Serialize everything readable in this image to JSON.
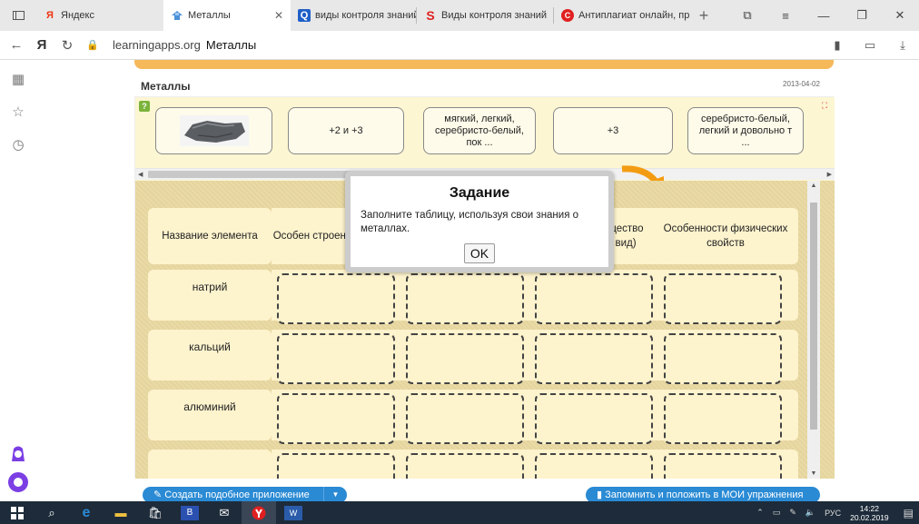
{
  "browser": {
    "tabs": [
      {
        "label": "Яндекс",
        "icon": "yandex-icon"
      },
      {
        "label": "Металлы",
        "icon": "learningapps-icon",
        "active": true
      },
      {
        "label": "виды контроля знаний",
        "icon": "search-icon"
      },
      {
        "label": "Виды контроля знаний",
        "icon": "s-icon"
      },
      {
        "label": "Антиплагиат онлайн, пр",
        "icon": "c-icon"
      }
    ],
    "url_host": "learningapps.org",
    "url_title": "Металлы"
  },
  "app": {
    "title": "Металлы",
    "date": "2013-04-02",
    "cards": [
      {
        "type": "image",
        "label": ""
      },
      {
        "type": "text",
        "label": "+2 и +3"
      },
      {
        "type": "text",
        "label": "мягкий, легкий, серебристо-белый, пок ..."
      },
      {
        "type": "text",
        "label": "+3"
      },
      {
        "type": "text",
        "label": "серебристо-белый, легкий и довольно т ..."
      }
    ],
    "table": {
      "headers": [
        "Название элемента",
        "Особен строени",
        "",
        "щество вид)",
        "Особенности физических свойств"
      ],
      "rows": [
        "натрий",
        "кальций",
        "алюминий"
      ]
    }
  },
  "modal": {
    "title": "Задание",
    "text": "Заполните таблицу, используя свои знания о металлах.",
    "ok": "OK"
  },
  "buttons": {
    "create": "Создать подобное приложение",
    "save": "Запомнить и положить в МОИ упражнения"
  },
  "taskbar": {
    "lang": "РУС",
    "time": "14:22",
    "date": "20.02.2019"
  },
  "colors": {
    "accent_blue": "#2a8ad4",
    "app_bg": "#fdf6d2",
    "table_bg": "#e9d8a0",
    "orange": "#f39c12"
  }
}
